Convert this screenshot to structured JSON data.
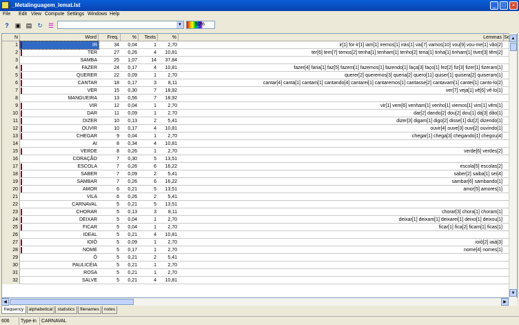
{
  "window": {
    "title": "_Metalinguagem_lemat.lst"
  },
  "menu": [
    "File",
    "Edit",
    "View",
    "Compute",
    "Settings",
    "Windows",
    "Help"
  ],
  "toolbar": {
    "progress_label": "50%",
    "combo_value": ""
  },
  "columns": {
    "n": "N",
    "word": "Word",
    "freq": "Freq.",
    "pct": "%",
    "texts": "Texts",
    "pct2": "%",
    "lemmas": "Lemmas",
    "se": "Se"
  },
  "rows": [
    {
      "n": "1",
      "word": "IR",
      "freq": "34",
      "pct": "0,04",
      "texts": "1",
      "pct2": "2,70",
      "lemmas": "ir[1] for-ir[1] iam[1] iremos[1] irás[1] vai[7] vamos[10] vou[9] vou-me[1] vão[2]",
      "mark": true
    },
    {
      "n": "2",
      "word": "TER",
      "freq": "27",
      "pct": "0,26",
      "texts": "4",
      "pct2": "10,81",
      "lemmas": "ter[6] tem[7] temos[2] tenha[1] tenham[1] tenho[2] teria[1] tinha[1] tinham[1] tiver[3] têm[2]",
      "mark": true
    },
    {
      "n": "3",
      "word": "SAMBA",
      "freq": "25",
      "pct": "1,07",
      "texts": "14",
      "pct2": "37,84",
      "lemmas": "",
      "mark": false
    },
    {
      "n": "4",
      "word": "FAZER",
      "freq": "24",
      "pct": "0,17",
      "texts": "4",
      "pct2": "10,81",
      "lemmas": "fazer[4] faria[1] faz[5] fazem[1] fazemos[1] fazendo[1] faça[3] faço[1] fez[2] fiz[3] fizer[1] fizeram[1]",
      "mark": true
    },
    {
      "n": "5",
      "word": "QUERER",
      "freq": "22",
      "pct": "0,09",
      "texts": "1",
      "pct2": "2,70",
      "lemmas": "querer[2] queremos[3] queria[2] quero[11] quiser[1] quisera[2] quiseram[1]",
      "mark": true
    },
    {
      "n": "6",
      "word": "CANTAR",
      "freq": "18",
      "pct": "0,17",
      "texts": "3",
      "pct2": "8,11",
      "lemmas": "cantar[4] canta[1] cantam[1] cantando[4] cantarei[1] cantaremos[1] cantasse[2] cantavam[1] cantei[1] canto-lo[2]",
      "mark": true
    },
    {
      "n": "7",
      "word": "VER",
      "freq": "15",
      "pct": "0,30",
      "texts": "7",
      "pct2": "18,92",
      "lemmas": "ver[7] veja[1] vê[6] vê-lo[1]",
      "mark": true
    },
    {
      "n": "8",
      "word": "MANGUEIRA",
      "freq": "13",
      "pct": "0,56",
      "texts": "7",
      "pct2": "18,92",
      "lemmas": "",
      "mark": false
    },
    {
      "n": "9",
      "word": "VIR",
      "freq": "12",
      "pct": "0,04",
      "texts": "1",
      "pct2": "2,70",
      "lemmas": "vir[1] vem[6] venham[1] venho[1] viemos[1] vim[1] vêm[1]",
      "mark": true
    },
    {
      "n": "10",
      "word": "DAR",
      "freq": "11",
      "pct": "0,09",
      "texts": "1",
      "pct2": "2,70",
      "lemmas": "dar[2] dando[2] dou[2] dou[1] dá[3] dão[1]",
      "mark": true
    },
    {
      "n": "11",
      "word": "DIZER",
      "freq": "10",
      "pct": "0,13",
      "texts": "2",
      "pct2": "5,41",
      "lemmas": "dizer[3] digam[1] digo[2] disse[1] diz[2] dizendo[1]",
      "mark": true
    },
    {
      "n": "12",
      "word": "OUVIR",
      "freq": "10",
      "pct": "0,17",
      "texts": "4",
      "pct2": "10,81",
      "lemmas": "ouvir[4] ouve[3] ouvi[2] ouvindo[1]",
      "mark": true
    },
    {
      "n": "13",
      "word": "CHEGAR",
      "freq": "9",
      "pct": "0,04",
      "texts": "1",
      "pct2": "2,70",
      "lemmas": "chegar[1] chega[3] chegando[1] chegou[4]",
      "mark": true
    },
    {
      "n": "14",
      "word": "AI",
      "freq": "8",
      "pct": "0,34",
      "texts": "4",
      "pct2": "10,81",
      "lemmas": "",
      "mark": false
    },
    {
      "n": "15",
      "word": "VERDE",
      "freq": "8",
      "pct": "0,26",
      "texts": "1",
      "pct2": "2,70",
      "lemmas": "verde[6] verdes[2]",
      "mark": true
    },
    {
      "n": "16",
      "word": "CORAÇÃO",
      "freq": "7",
      "pct": "0,30",
      "texts": "5",
      "pct2": "13,51",
      "lemmas": "",
      "mark": false
    },
    {
      "n": "17",
      "word": "ESCOLA",
      "freq": "7",
      "pct": "0,26",
      "texts": "6",
      "pct2": "16,22",
      "lemmas": "escola[5] escolas[2]",
      "mark": true
    },
    {
      "n": "18",
      "word": "SABER",
      "freq": "7",
      "pct": "0,09",
      "texts": "2",
      "pct2": "5,41",
      "lemmas": "saber[2] saiba[1] sei[4]",
      "mark": true
    },
    {
      "n": "19",
      "word": "SAMBAR",
      "freq": "7",
      "pct": "0,26",
      "texts": "6",
      "pct2": "16,22",
      "lemmas": "sambar[6] sambando[1]",
      "mark": true
    },
    {
      "n": "20",
      "word": "AMOR",
      "freq": "6",
      "pct": "0,21",
      "texts": "5",
      "pct2": "13,51",
      "lemmas": "amor[5] amores[1]",
      "mark": true
    },
    {
      "n": "21",
      "word": "VILA",
      "freq": "6",
      "pct": "0,26",
      "texts": "2",
      "pct2": "5,41",
      "lemmas": "",
      "mark": false
    },
    {
      "n": "22",
      "word": "CARNAVAL",
      "freq": "5",
      "pct": "0,21",
      "texts": "5",
      "pct2": "13,51",
      "lemmas": "",
      "mark": false
    },
    {
      "n": "23",
      "word": "CHORAR",
      "freq": "5",
      "pct": "0,13",
      "texts": "3",
      "pct2": "8,11",
      "lemmas": "chorar[3] chora[1] choram[1]",
      "mark": true
    },
    {
      "n": "24",
      "word": "DEIXAR",
      "freq": "5",
      "pct": "0,04",
      "texts": "1",
      "pct2": "2,70",
      "lemmas": "deixar[1] deixam[1] deixarei[1] deixo[1] deixou[1]",
      "mark": true
    },
    {
      "n": "25",
      "word": "FICAR",
      "freq": "5",
      "pct": "0,04",
      "texts": "1",
      "pct2": "2,70",
      "lemmas": "ficar[1] fica[2] ficam[1] ficas[1]",
      "mark": true
    },
    {
      "n": "26",
      "word": "IDEAL",
      "freq": "5",
      "pct": "0,21",
      "texts": "4",
      "pct2": "10,81",
      "lemmas": "",
      "mark": false
    },
    {
      "n": "27",
      "word": "IOIÔ",
      "freq": "5",
      "pct": "0,09",
      "texts": "1",
      "pct2": "2,70",
      "lemmas": "ioiô[2] iaiá[3]",
      "mark": true
    },
    {
      "n": "28",
      "word": "NOME",
      "freq": "5",
      "pct": "0,17",
      "texts": "1",
      "pct2": "2,70",
      "lemmas": "nome[4] nomes[1]",
      "mark": true
    },
    {
      "n": "29",
      "word": "Ô",
      "freq": "5",
      "pct": "0,21",
      "texts": "2",
      "pct2": "5,41",
      "lemmas": "",
      "mark": false
    },
    {
      "n": "30",
      "word": "PAULICÉIA",
      "freq": "5",
      "pct": "0,21",
      "texts": "1",
      "pct2": "2,70",
      "lemmas": "",
      "mark": false
    },
    {
      "n": "31",
      "word": "ROSA",
      "freq": "5",
      "pct": "0,21",
      "texts": "1",
      "pct2": "2,70",
      "lemmas": "",
      "mark": false
    },
    {
      "n": "32",
      "word": "SALVE",
      "freq": "5",
      "pct": "0,21",
      "texts": "4",
      "pct2": "10,81",
      "lemmas": "",
      "mark": false
    }
  ],
  "tabs": [
    "frequency",
    "alphabetical",
    "statistics",
    "filenames",
    "notes"
  ],
  "status": {
    "count": "606",
    "type": "Type-in",
    "word": "CARNAVAL"
  }
}
